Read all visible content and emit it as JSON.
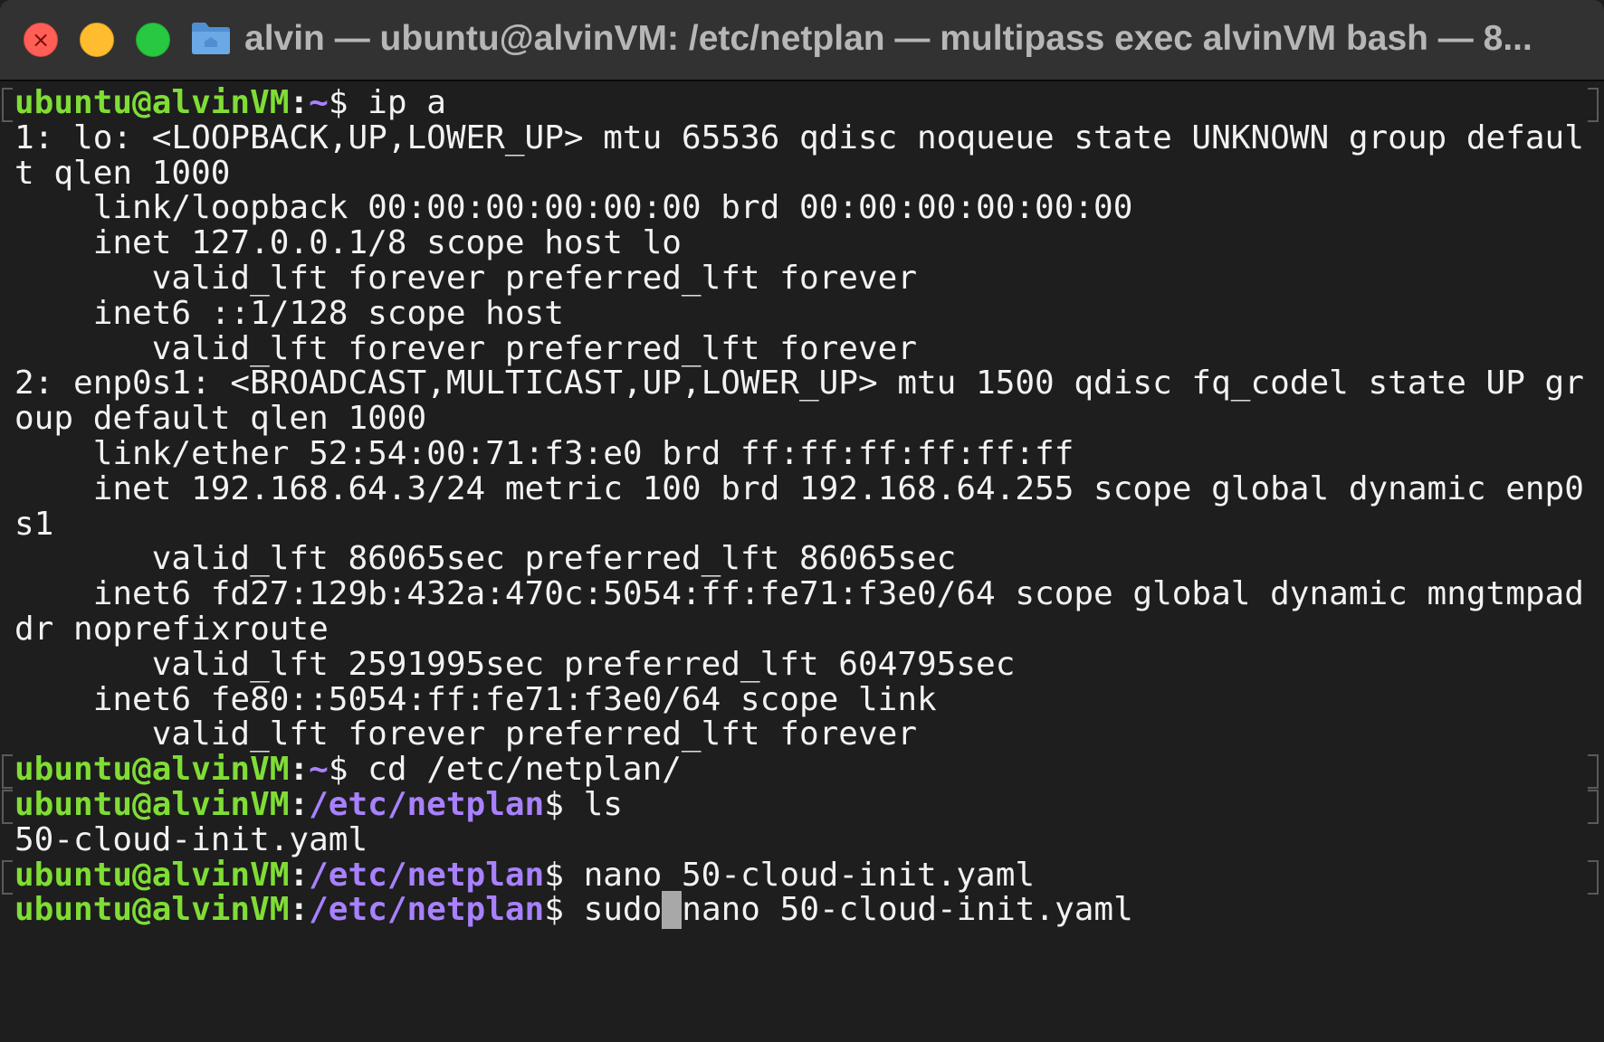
{
  "window": {
    "title": "alvin — ubuntu@alvinVM: /etc/netplan — multipass exec alvinVM bash — 8...",
    "traffic_lights": {
      "close": "#ff5f57",
      "minimize": "#febc2e",
      "zoom": "#28c840"
    }
  },
  "colors": {
    "background": "#1e1e1e",
    "text": "#f2f2f2",
    "prompt_user": "#7fdd35",
    "prompt_path": "#a881ff"
  },
  "terminal": {
    "lines": [
      {
        "type": "prompt",
        "user": "ubuntu@alvinVM",
        "path": "~",
        "command": "ip a"
      },
      {
        "type": "output",
        "text": "1: lo: <LOOPBACK,UP,LOWER_UP> mtu 65536 qdisc noqueue state UNKNOWN group defaul"
      },
      {
        "type": "output",
        "text": "t qlen 1000"
      },
      {
        "type": "output",
        "text": "    link/loopback 00:00:00:00:00:00 brd 00:00:00:00:00:00"
      },
      {
        "type": "output",
        "text": "    inet 127.0.0.1/8 scope host lo"
      },
      {
        "type": "output",
        "text": "       valid_lft forever preferred_lft forever"
      },
      {
        "type": "output",
        "text": "    inet6 ::1/128 scope host"
      },
      {
        "type": "output",
        "text": "       valid_lft forever preferred_lft forever"
      },
      {
        "type": "output",
        "text": "2: enp0s1: <BROADCAST,MULTICAST,UP,LOWER_UP> mtu 1500 qdisc fq_codel state UP gr"
      },
      {
        "type": "output",
        "text": "oup default qlen 1000"
      },
      {
        "type": "output",
        "text": "    link/ether 52:54:00:71:f3:e0 brd ff:ff:ff:ff:ff:ff"
      },
      {
        "type": "output",
        "text": "    inet 192.168.64.3/24 metric 100 brd 192.168.64.255 scope global dynamic enp0"
      },
      {
        "type": "output",
        "text": "s1"
      },
      {
        "type": "output",
        "text": "       valid_lft 86065sec preferred_lft 86065sec"
      },
      {
        "type": "output",
        "text": "    inet6 fd27:129b:432a:470c:5054:ff:fe71:f3e0/64 scope global dynamic mngtmpad"
      },
      {
        "type": "output",
        "text": "dr noprefixroute"
      },
      {
        "type": "output",
        "text": "       valid_lft 2591995sec preferred_lft 604795sec"
      },
      {
        "type": "output",
        "text": "    inet6 fe80::5054:ff:fe71:f3e0/64 scope link"
      },
      {
        "type": "output",
        "text": "       valid_lft forever preferred_lft forever"
      },
      {
        "type": "prompt",
        "user": "ubuntu@alvinVM",
        "path": "~",
        "command": "cd /etc/netplan/"
      },
      {
        "type": "prompt",
        "user": "ubuntu@alvinVM",
        "path": "/etc/netplan",
        "command": "ls"
      },
      {
        "type": "output",
        "text": "50-cloud-init.yaml"
      },
      {
        "type": "prompt",
        "user": "ubuntu@alvinVM",
        "path": "/etc/netplan",
        "command": "nano 50-cloud-init.yaml"
      },
      {
        "type": "active_prompt",
        "user": "ubuntu@alvinVM",
        "path": "/etc/netplan",
        "command_before_cursor": "sudo",
        "command_after_cursor": "nano 50-cloud-init.yaml"
      }
    ]
  }
}
